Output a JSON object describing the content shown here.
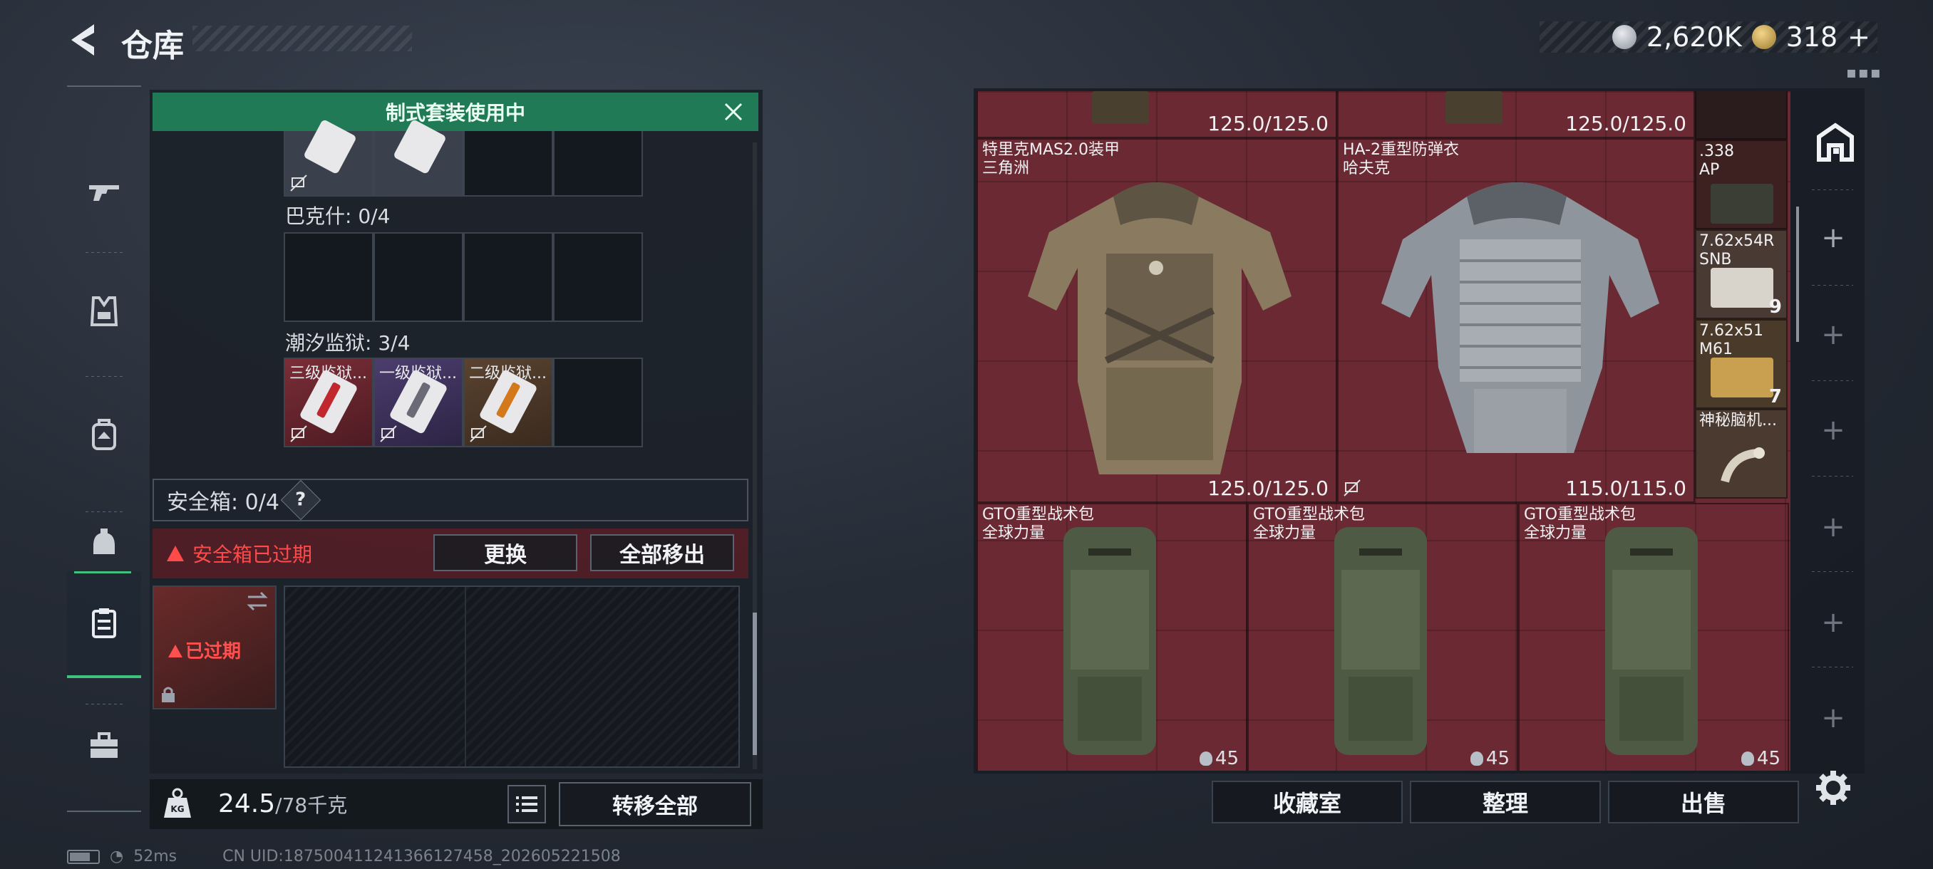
{
  "header": {
    "title": "仓库",
    "currency_silver": "2,620K",
    "currency_gold": "318",
    "currency_gold_plus": "+"
  },
  "nav": {
    "items": [
      "weapon-icon",
      "armor-vest-icon",
      "backpack-icon",
      "helmet-bag-icon",
      "safe-box-icon",
      "toolbox-icon"
    ],
    "active": "safe-box-icon"
  },
  "left": {
    "banner": "制式套装使用中",
    "bakshi_label": "巴克什: 0/4",
    "tidal_label": "潮汐监狱: 3/4",
    "tidal_cards": [
      "三级监狱...",
      "一级监狱...",
      "二级监狱..."
    ],
    "safe_box_label": "安全箱: 0/4",
    "help": "?",
    "expired_msg": "安全箱已过期",
    "replace_btn": "更换",
    "move_all_btn": "全部移出",
    "safebox_expired": "已过期",
    "weight_value": "24.5",
    "weight_max": "/78千克",
    "transfer_all_btn": "转移全部"
  },
  "status": {
    "ping": "52ms",
    "uid": "CN UID:18750041124136612745​8_202605221508"
  },
  "right": {
    "top_durs": [
      "125.0/125.0",
      "125.0/125.0"
    ],
    "armor1_name": "特里克MAS2.0装甲\n三角洲",
    "armor1_dur": "125.0/125.0",
    "armor2_name": "HA-2重型防弹衣\n哈夫克",
    "armor2_dur": "115.0/115.0",
    "bag_name": "GTO重型战术包\n全球力量",
    "bag_cap": "45",
    "ammo": [
      {
        "name": ".338\nAP",
        "count": ""
      },
      {
        "name": "7.62x54R\nSNB",
        "count": "9"
      },
      {
        "name": "7.62x51\nM61",
        "count": "7"
      },
      {
        "name": "神秘脑机...",
        "count": ""
      }
    ],
    "btn_collection": "收藏室",
    "btn_sort": "整理",
    "btn_sell": "出售"
  },
  "colors": {
    "accent_green": "#1f7a55",
    "item_bg_red": "#6b2a33",
    "warning_red": "#ff4a4a"
  }
}
